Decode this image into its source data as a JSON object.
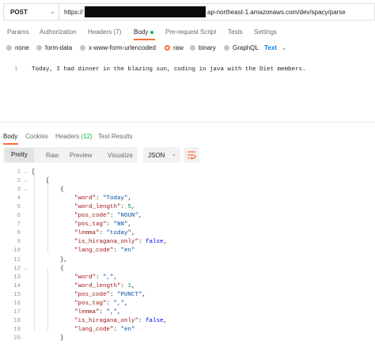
{
  "request": {
    "method": "POST",
    "url_prefix": "https://",
    "url_suffix": "ap-northeast-1.amazonaws.com/dev/spacy/parse"
  },
  "request_tabs": [
    "Params",
    "Authorization",
    "Headers (7)",
    "Body",
    "Pre-request Script",
    "Tests",
    "Settings"
  ],
  "body_options": [
    "none",
    "form-data",
    "x-www-form-urlencoded",
    "raw",
    "binary",
    "GraphQL"
  ],
  "body_type": "Text",
  "editor": {
    "line_number": "1",
    "text": "Today, I had dinner in the blazing sun, coding in java with the Diet members."
  },
  "response_tabs": {
    "body": "Body",
    "cookies": "Cookies",
    "headers_label": "Headers",
    "headers_count": "(12)",
    "test_results": "Test Results"
  },
  "view_modes": [
    "Pretty",
    "Raw",
    "Preview",
    "Visualize"
  ],
  "format": "JSON",
  "colors": {
    "accent": "#ff6c37",
    "green": "#0cbb52",
    "blue": "#097bed"
  },
  "response_lines": [
    {
      "n": "1",
      "t": "["
    },
    {
      "n": "2",
      "t": "    ["
    },
    {
      "n": "3",
      "t": "        {"
    },
    {
      "n": "4",
      "t": "            \"word\": \"Today\","
    },
    {
      "n": "5",
      "t": "            \"word_length\": 5,"
    },
    {
      "n": "6",
      "t": "            \"pos_code\": \"NOUN\","
    },
    {
      "n": "7",
      "t": "            \"pos_tag\": \"NN\","
    },
    {
      "n": "8",
      "t": "            \"lemma\": \"today\","
    },
    {
      "n": "9",
      "t": "            \"is_hiragana_only\": false,"
    },
    {
      "n": "10",
      "t": "            \"lang_code\": \"en\""
    },
    {
      "n": "11",
      "t": "        },"
    },
    {
      "n": "12",
      "t": "        {"
    },
    {
      "n": "13",
      "t": "            \"word\": \",\","
    },
    {
      "n": "14",
      "t": "            \"word_length\": 1,"
    },
    {
      "n": "15",
      "t": "            \"pos_code\": \"PUNCT\","
    },
    {
      "n": "16",
      "t": "            \"pos_tag\": \",\","
    },
    {
      "n": "17",
      "t": "            \"lemma\": \",\","
    },
    {
      "n": "18",
      "t": "            \"is_hiragana_only\": false,"
    },
    {
      "n": "19",
      "t": "            \"lang_code\": \"en\""
    },
    {
      "n": "20",
      "t": "        }"
    }
  ]
}
